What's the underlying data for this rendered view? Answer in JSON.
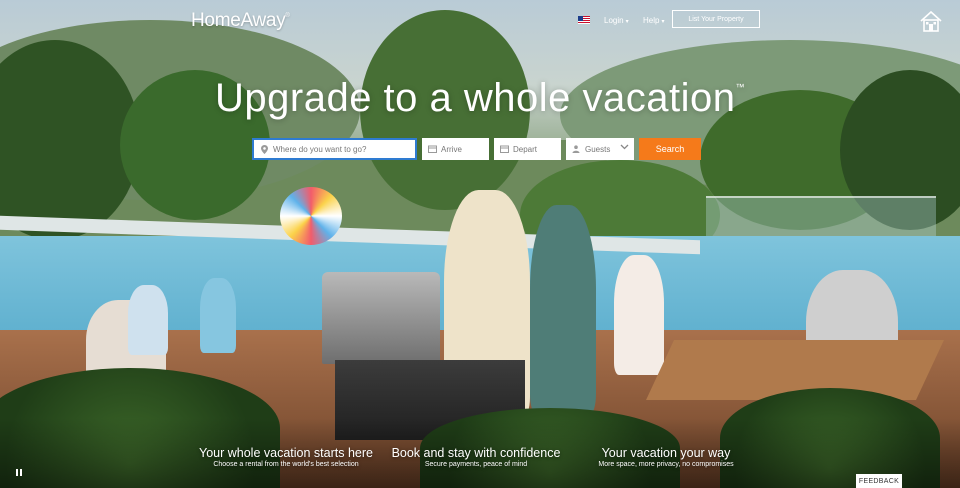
{
  "header": {
    "logo_text": "HomeAway",
    "logo_mark": "®",
    "login_label": "Login",
    "help_label": "Help",
    "list_property_label": "List Your Property",
    "flag_icon": "us-flag-icon",
    "house_icon": "house-icon"
  },
  "hero": {
    "title": "Upgrade to a whole vacation",
    "title_mark": "™"
  },
  "search": {
    "where_placeholder": "Where do you want to go?",
    "arrive_placeholder": "Arrive",
    "depart_placeholder": "Depart",
    "guests_label": "Guests",
    "button_label": "Search",
    "button_color": "#f57a1a"
  },
  "value_props": [
    {
      "heading": "Your whole vacation starts here",
      "sub": "Choose a rental from the world's best selection"
    },
    {
      "heading": "Book and stay with confidence",
      "sub": "Secure payments, peace of mind"
    },
    {
      "heading": "Your vacation your way",
      "sub": "More space, more privacy, no compromises"
    }
  ],
  "controls": {
    "pause_icon": "pause-icon",
    "feedback_label": "FEEDBACK"
  }
}
